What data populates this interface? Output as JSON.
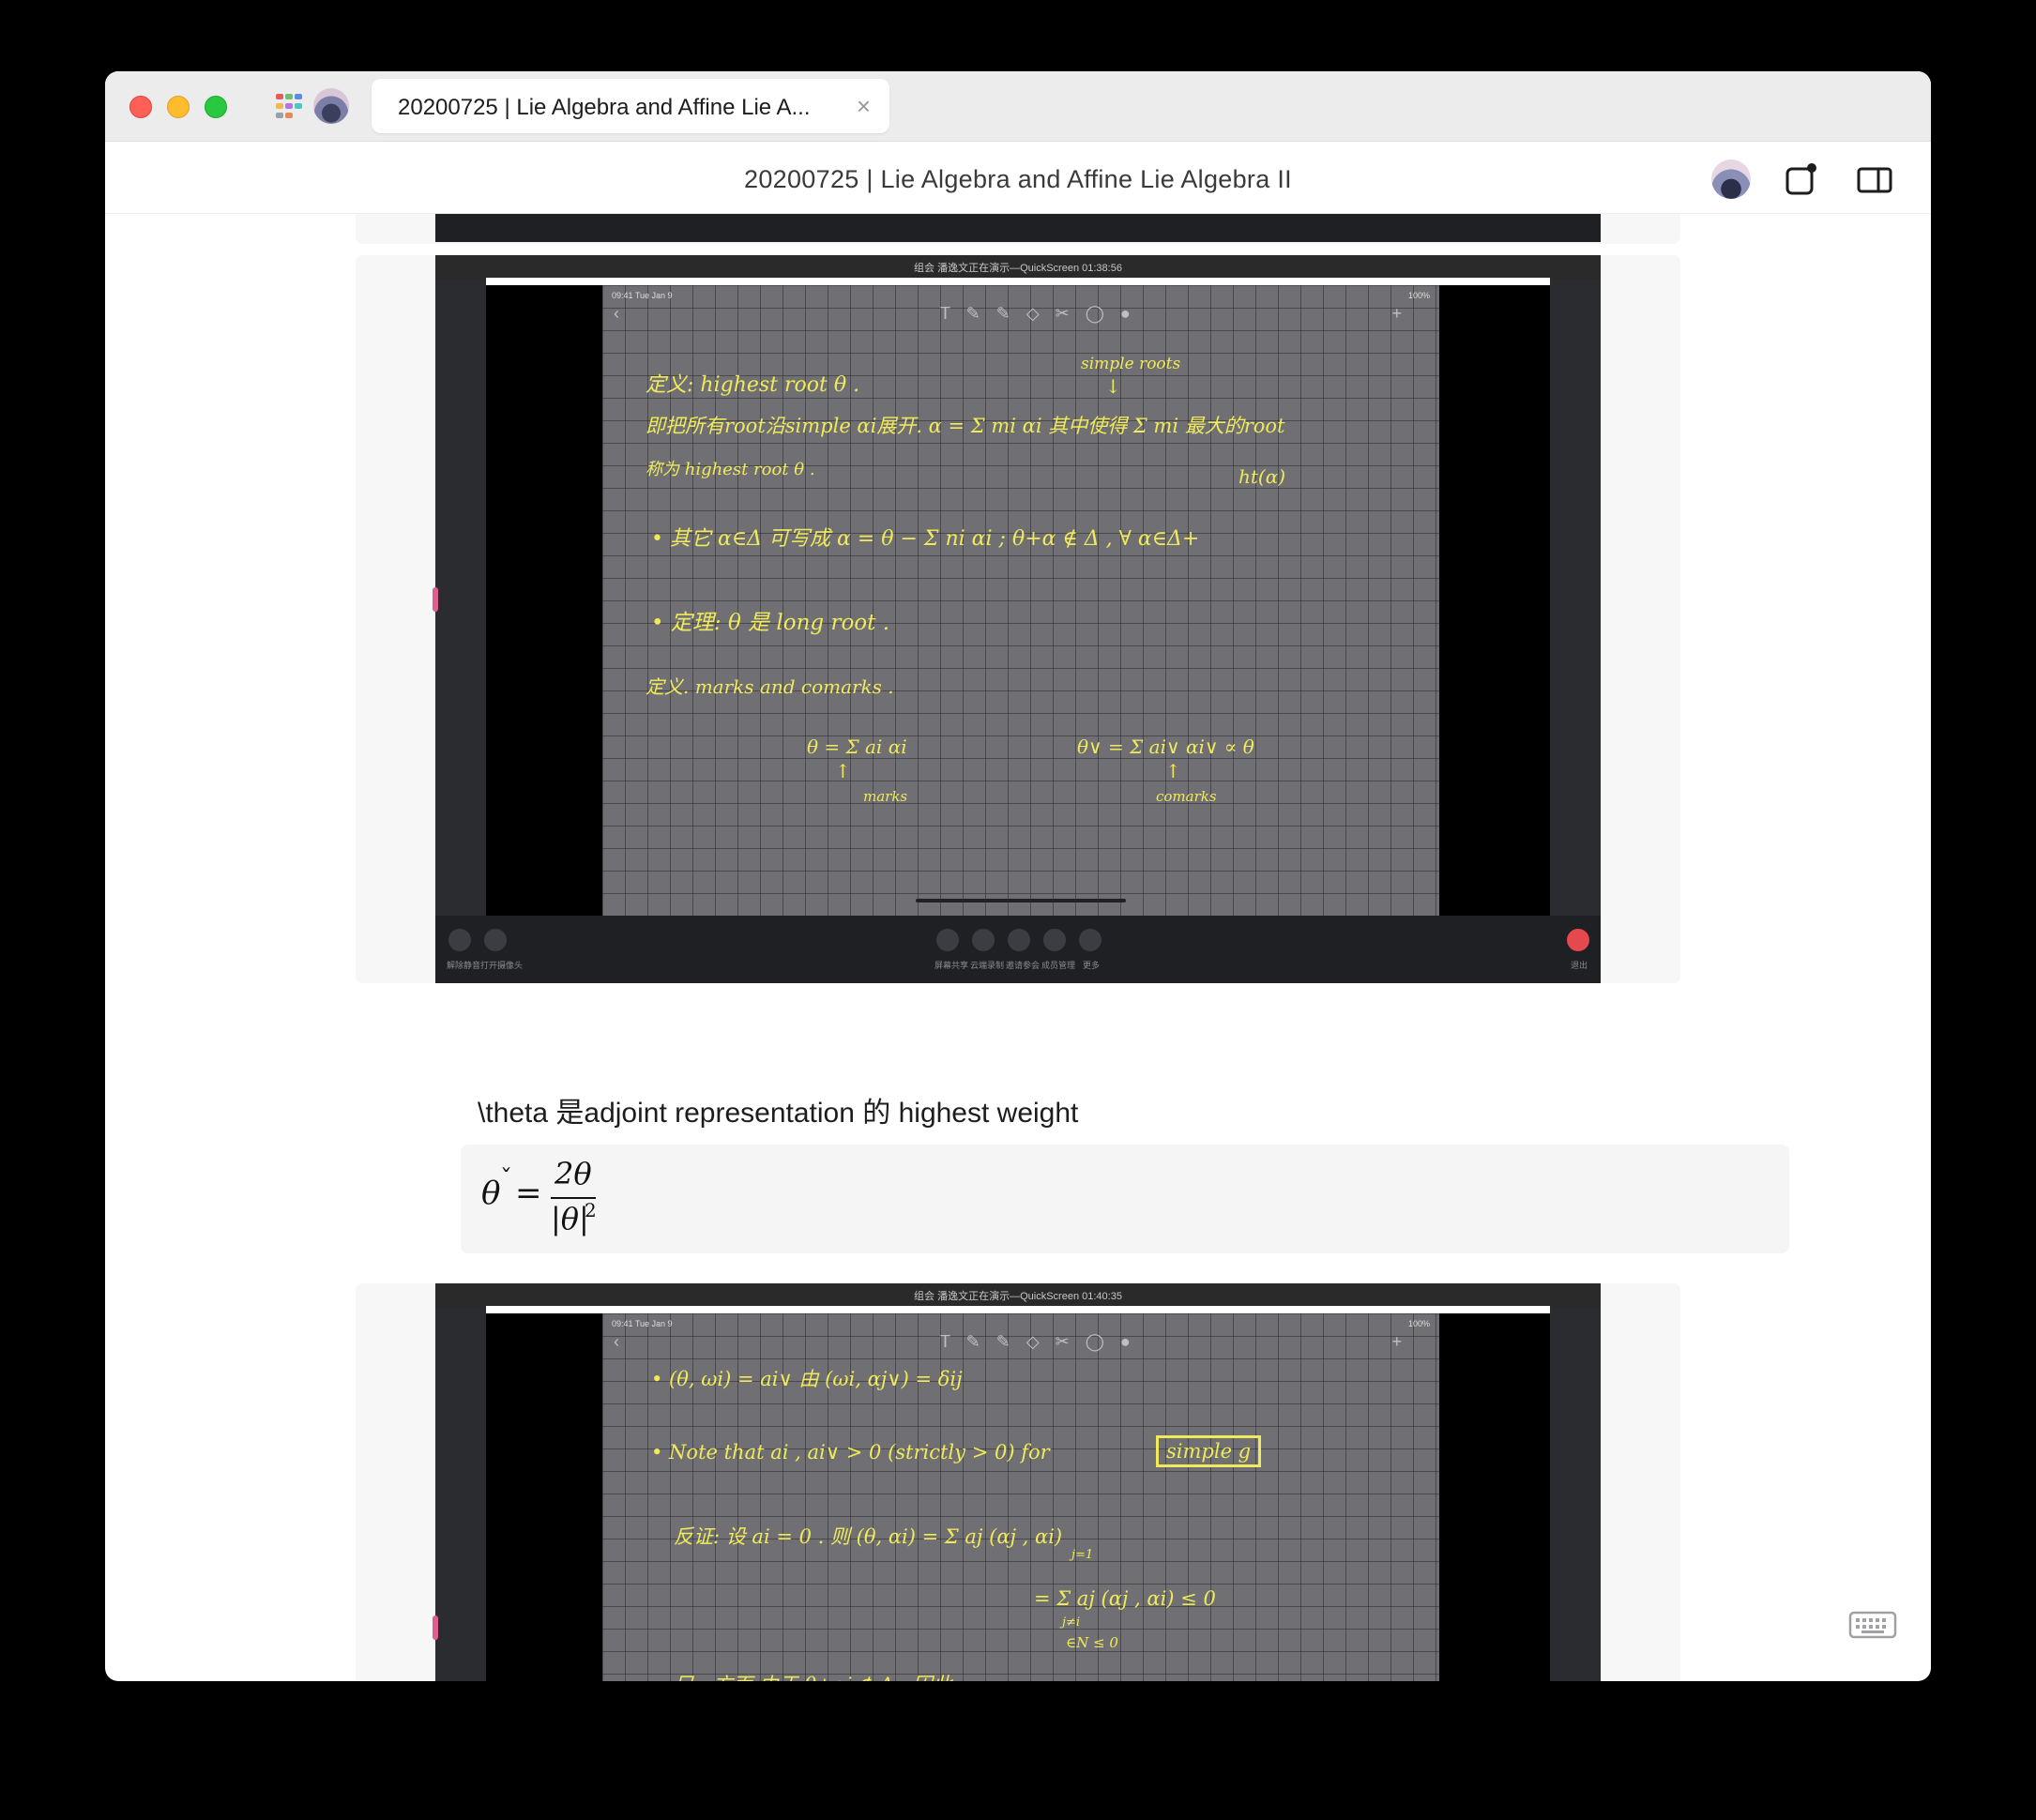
{
  "window": {
    "tab_title": "20200725 | Lie Algebra and Affine Lie A...",
    "tab_close": "×",
    "doc_title": "20200725 | Lie Algebra and Affine Lie Algebra II"
  },
  "colors": {
    "close": "#fe5f57",
    "minimize": "#febc2e",
    "zoom": "#28c840",
    "chalk": "#f0ea5a",
    "board": "#707074"
  },
  "slide1": {
    "caption": "组会  潘逸文正在演示—QuickScreen  01:38:56",
    "status_left": "09:41  Tue Jan 9",
    "status_right": "100%",
    "lines": [
      "定义: highest root θ .",
      "simple roots",
      "即把所有root沿simple αi展开.   α = Σ mi αi   其中使得 Σ mi 最大的root",
      "称为 highest root θ .",
      "ht(α)",
      "• 其它 α∈Δ 可写成 α = θ − Σ ni αi ;     θ+α ∉ Δ , ∀ α∈Δ+",
      "• 定理: θ 是 long root .",
      "定义. marks  and  comarks .",
      "θ = Σ ai αi",
      "marks",
      "θ∨ = Σ ai∨ αi∨  ∝ θ",
      "comarks"
    ],
    "bottom_labels": [
      "解除静音",
      "打开摄像头",
      "屏幕共享",
      "云端录制",
      "邀请参会",
      "成员管理",
      "更多",
      "退出"
    ]
  },
  "paragraph": "\\theta 是adjoint representation 的 highest weight",
  "formula": {
    "lhs": "θ",
    "breve": "ˇ",
    "eq": "=",
    "numerator": "2θ",
    "denominator": "|θ|",
    "exponent": "2"
  },
  "slide2": {
    "caption": "组会  潘逸文正在演示—QuickScreen  01:40:35",
    "status_left": "09:41  Tue Jan 9",
    "status_right": "100%",
    "lines": [
      "• (θ, ωi) = ai∨      由 (ωi, αj∨) = δij",
      "• Note  that   ai , ai∨ > 0  (strictly > 0)      for",
      "simple g",
      "反证: 设  ai = 0 .   则  (θ, αi) = Σ aj (αj , αi)",
      "j=1",
      "= Σ aj (αj , αi)     ≤ 0",
      "j≠i",
      "∈N        ≤ 0",
      "另一方面 由于  θ+αi ∉ Δ .   因此"
    ]
  },
  "right_sidebar": {
    "add": "+",
    "font": "Aa"
  }
}
